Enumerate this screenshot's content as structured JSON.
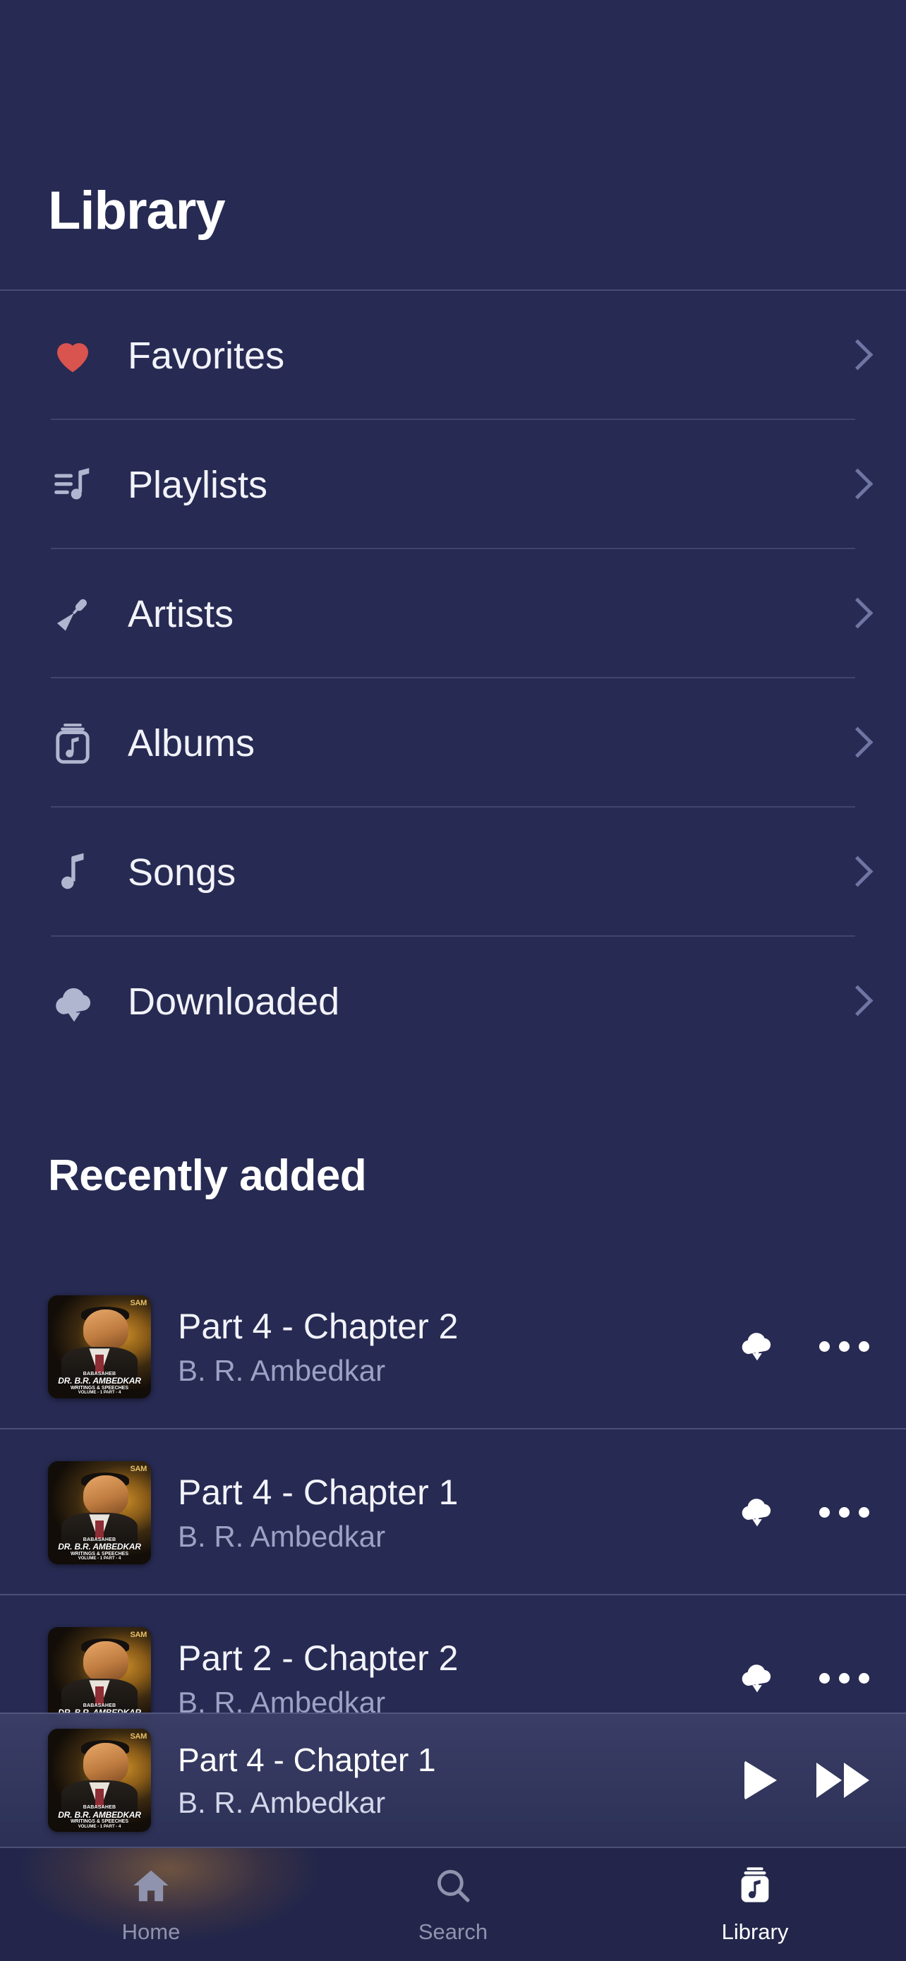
{
  "header": {
    "title": "Library"
  },
  "library": {
    "items": [
      {
        "label": "Favorites",
        "icon": "heart-icon"
      },
      {
        "label": "Playlists",
        "icon": "playlist-icon"
      },
      {
        "label": "Artists",
        "icon": "microphone-icon"
      },
      {
        "label": "Albums",
        "icon": "album-icon"
      },
      {
        "label": "Songs",
        "icon": "music-note-icon"
      },
      {
        "label": "Downloaded",
        "icon": "cloud-download-icon"
      }
    ]
  },
  "recently_added": {
    "title": "Recently added",
    "tracks": [
      {
        "title": "Part 4 - Chapter 2",
        "artist": "B. R. Ambedkar"
      },
      {
        "title": "Part 4 - Chapter 1",
        "artist": "B. R. Ambedkar"
      },
      {
        "title": "Part 2 - Chapter 2",
        "artist": "B. R. Ambedkar"
      }
    ]
  },
  "album_art": {
    "line1": "BABASAHEB",
    "line2": "DR. B.R. AMBEDKAR",
    "line3": "WRITINGS & SPEECHES",
    "line4": "VOLUME - 1 PART - 4",
    "logo": "SAM"
  },
  "mini_player": {
    "title": "Part 4 - Chapter 1",
    "artist": "B. R. Ambedkar"
  },
  "bottom_nav": {
    "items": [
      {
        "label": "Home",
        "icon": "home-icon",
        "active": false
      },
      {
        "label": "Search",
        "icon": "search-icon",
        "active": false
      },
      {
        "label": "Library",
        "icon": "album-icon",
        "active": true
      }
    ]
  },
  "colors": {
    "background": "#272a52",
    "accent_heart": "#d9534f",
    "icon_muted": "#b0b6cf",
    "text_secondary": "#9ba2c4",
    "nav_inactive": "#8f93ad"
  }
}
